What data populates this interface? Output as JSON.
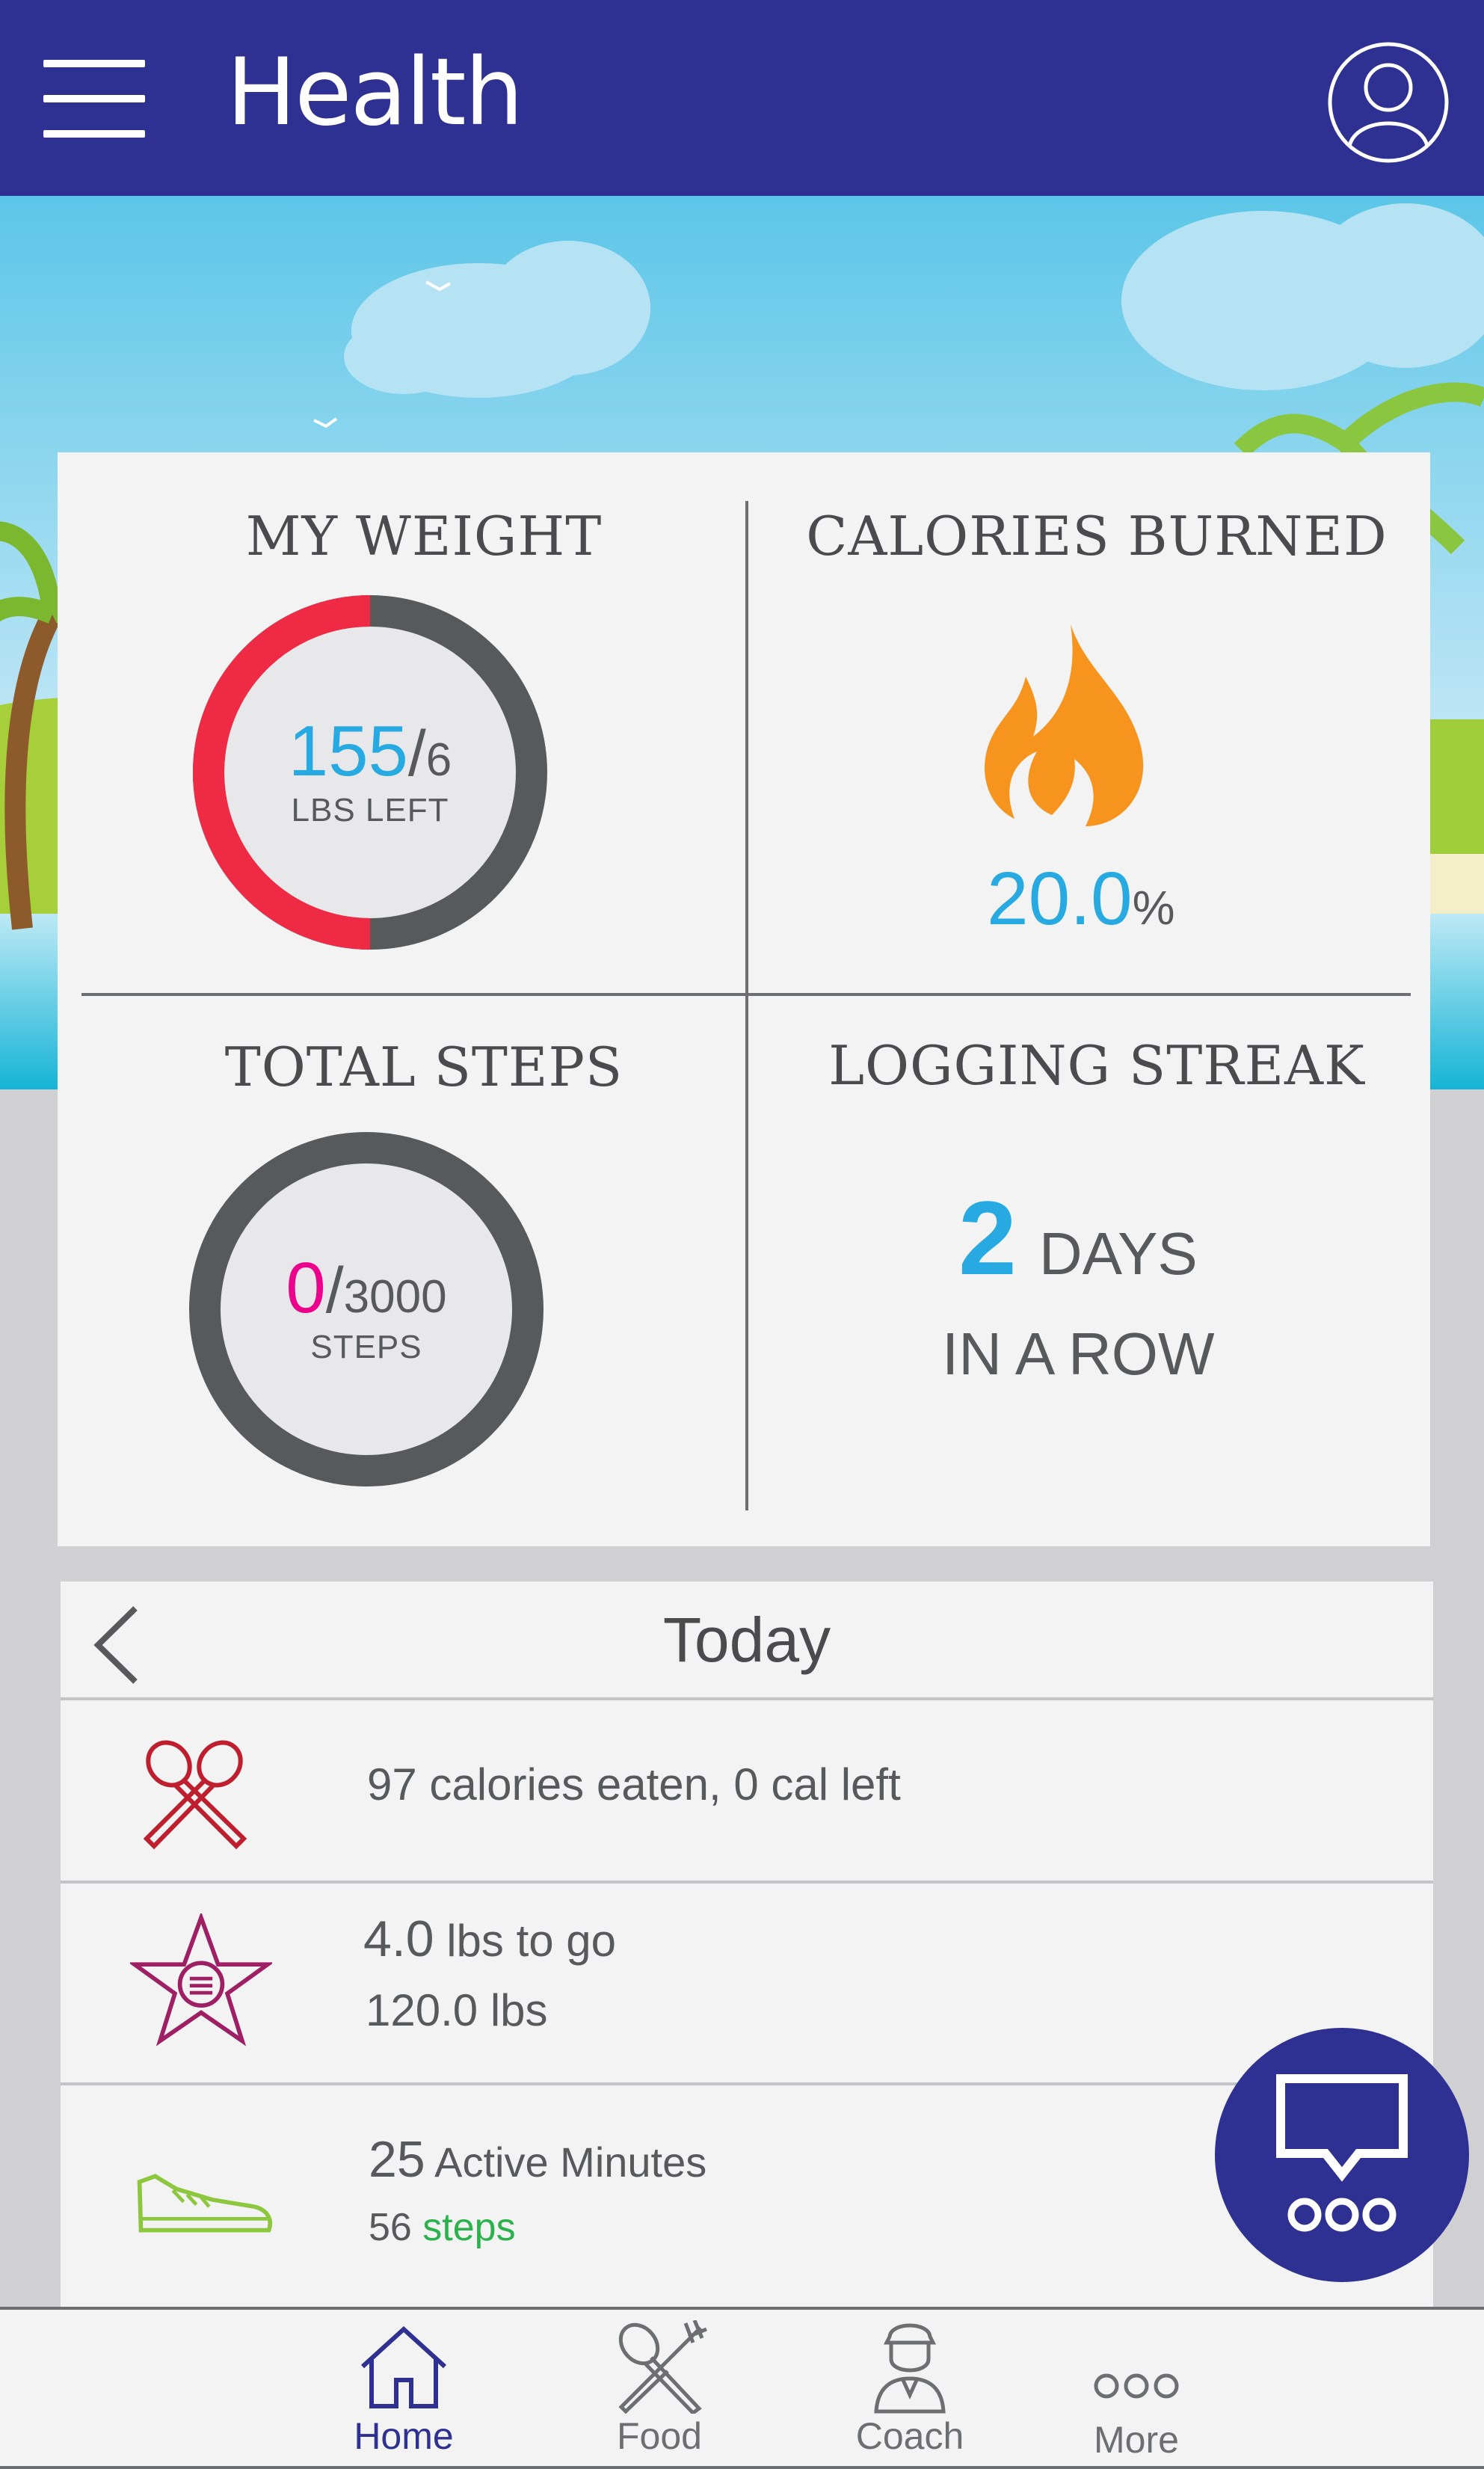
{
  "header": {
    "title": "Health",
    "menu_icon": "hamburger-menu-icon",
    "profile_icon": "user-profile-icon",
    "color": "#2e3192"
  },
  "stats": {
    "weight": {
      "title": "MY WEIGHT",
      "value": "155",
      "total": "6",
      "unit": "LBS LEFT",
      "progress": 0.5,
      "progress_color": "#ee2a44",
      "track_color": "#58595b"
    },
    "calories": {
      "title": "CALORIES BURNED",
      "icon": "flame-icon",
      "value": "20.0",
      "unit": "%"
    },
    "steps": {
      "title": "TOTAL STEPS",
      "value": "0",
      "goal": "3000",
      "unit": "STEPS",
      "progress": 0
    },
    "streak": {
      "title": "LOGGING STREAK",
      "value": "2",
      "unit": "DAYS",
      "caption": "IN A ROW"
    }
  },
  "today": {
    "title": "Today",
    "back_icon": "chevron-left-icon",
    "rows": [
      {
        "icon": "fork-spoon-icon",
        "text": "97 calories eaten, 0 cal left"
      },
      {
        "icon": "star-badge-icon",
        "value": "4.0",
        "text": " lbs to go",
        "line2": "120.0 lbs"
      },
      {
        "icon": "sneaker-icon",
        "value": "25",
        "text": " Active Minutes",
        "steps_value": "56",
        "steps_label": "steps"
      }
    ]
  },
  "fab": {
    "icon": "chat-bubble-icon"
  },
  "nav": [
    {
      "label": "Home",
      "icon": "home-icon",
      "active": true
    },
    {
      "label": "Food",
      "icon": "fork-spoon-icon",
      "active": false
    },
    {
      "label": "Coach",
      "icon": "coach-icon",
      "active": false
    },
    {
      "label": "More",
      "icon": "more-dots-icon",
      "active": false
    }
  ],
  "colors": {
    "accent": "#27aae1",
    "steps_zero": "#ec008c",
    "flame": "#f7941d",
    "steps_word": "#2bb24c"
  }
}
